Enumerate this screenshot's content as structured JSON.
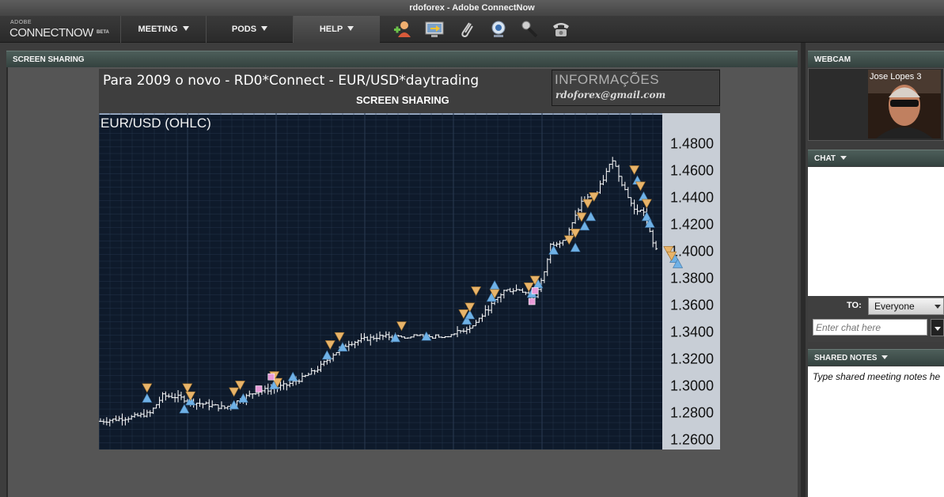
{
  "window": {
    "title": "rdoforex - Adobe ConnectNow"
  },
  "logo": {
    "adobe": "ADOBE",
    "name": "CONNECTNOW",
    "beta": "BETA"
  },
  "menus": {
    "meeting": "MEETING",
    "pods": "PODS",
    "help": "HELP"
  },
  "toolbar_icons": [
    "add-user-icon",
    "share-screen-icon",
    "attachment-icon",
    "webcam-icon",
    "microphone-icon",
    "phone-icon"
  ],
  "screen_sharing": {
    "header": "SCREEN SHARING",
    "banner_title": "Para 2009 o novo  -  RD0*Connect  - EUR/USD*daytrading",
    "banner_sub": "SCREEN SHARING",
    "info_title": "INFORMAÇÕES",
    "info_email": "rdoforex@gmail.com"
  },
  "chart_data": {
    "type": "ohlc",
    "title": "EUR/USD (OHLC)",
    "y_ticks": [
      "1.4800",
      "1.4600",
      "1.4400",
      "1.4200",
      "1.4000",
      "1.3800",
      "1.3600",
      "1.3400",
      "1.3200",
      "1.3000",
      "1.2800",
      "1.2600"
    ],
    "ylim": [
      1.252,
      1.502
    ],
    "grid": true,
    "bar_count": 180,
    "closes": [
      [
        0,
        1.273
      ],
      [
        10,
        1.276
      ],
      [
        16,
        1.279
      ],
      [
        20,
        1.292
      ],
      [
        25,
        1.291
      ],
      [
        30,
        1.287
      ],
      [
        40,
        1.283
      ],
      [
        45,
        1.289
      ],
      [
        50,
        1.295
      ],
      [
        55,
        1.297
      ],
      [
        60,
        1.3
      ],
      [
        65,
        1.305
      ],
      [
        70,
        1.312
      ],
      [
        75,
        1.323
      ],
      [
        80,
        1.331
      ],
      [
        85,
        1.334
      ],
      [
        90,
        1.336
      ],
      [
        96,
        1.336
      ],
      [
        100,
        1.336
      ],
      [
        110,
        1.336
      ],
      [
        115,
        1.339
      ],
      [
        120,
        1.344
      ],
      [
        125,
        1.357
      ],
      [
        130,
        1.37
      ],
      [
        135,
        1.371
      ],
      [
        140,
        1.366
      ],
      [
        143,
        1.383
      ],
      [
        145,
        1.404
      ],
      [
        150,
        1.409
      ],
      [
        155,
        1.436
      ],
      [
        160,
        1.443
      ],
      [
        165,
        1.468
      ],
      [
        168,
        1.45
      ],
      [
        172,
        1.43
      ],
      [
        175,
        1.429
      ],
      [
        178,
        1.405
      ],
      [
        182,
        1.392
      ],
      [
        190,
        1.392
      ]
    ],
    "buy_markers": [
      [
        15,
        1.29
      ],
      [
        27,
        1.282
      ],
      [
        29,
        1.288
      ],
      [
        43,
        1.285
      ],
      [
        46,
        1.29
      ],
      [
        56,
        1.3
      ],
      [
        62,
        1.306
      ],
      [
        73,
        1.322
      ],
      [
        78,
        1.328
      ],
      [
        95,
        1.335
      ],
      [
        105,
        1.336
      ],
      [
        118,
        1.348
      ],
      [
        119,
        1.352
      ],
      [
        126,
        1.365
      ],
      [
        127,
        1.374
      ],
      [
        139,
        1.368
      ],
      [
        141,
        1.375
      ],
      [
        146,
        1.4
      ],
      [
        153,
        1.402
      ],
      [
        156,
        1.418
      ],
      [
        158,
        1.425
      ],
      [
        173,
        1.452
      ],
      [
        175,
        1.44
      ],
      [
        176,
        1.425
      ],
      [
        177,
        1.42
      ],
      [
        185,
        1.394
      ],
      [
        186,
        1.39
      ]
    ],
    "sell_markers": [
      [
        15,
        1.298
      ],
      [
        28,
        1.298
      ],
      [
        29,
        1.292
      ],
      [
        43,
        1.295
      ],
      [
        45,
        1.3
      ],
      [
        56,
        1.307
      ],
      [
        57,
        1.302
      ],
      [
        74,
        1.33
      ],
      [
        77,
        1.336
      ],
      [
        97,
        1.344
      ],
      [
        117,
        1.353
      ],
      [
        119,
        1.358
      ],
      [
        121,
        1.37
      ],
      [
        127,
        1.368
      ],
      [
        138,
        1.373
      ],
      [
        140,
        1.378
      ],
      [
        151,
        1.408
      ],
      [
        153,
        1.413
      ],
      [
        155,
        1.425
      ],
      [
        157,
        1.435
      ],
      [
        159,
        1.44
      ],
      [
        172,
        1.46
      ],
      [
        174,
        1.448
      ],
      [
        176,
        1.435
      ],
      [
        183,
        1.4
      ],
      [
        184,
        1.396
      ]
    ],
    "exit_markers": [
      [
        51,
        1.297
      ],
      [
        55,
        1.306
      ],
      [
        139,
        1.362
      ],
      [
        140,
        1.37
      ]
    ],
    "colors": {
      "background": "#0e1a2b",
      "grid": "#2a3a52",
      "axis_panel": "#c8ced6",
      "bar": "#ffffff",
      "buy": "#6fb1e6",
      "sell": "#e8b46a",
      "exit": "#e89ad8"
    }
  },
  "webcam": {
    "header": "WEBCAM",
    "participant": "Jose Lopes 3"
  },
  "chat": {
    "header": "CHAT",
    "to_label": "TO:",
    "to_value": "Everyone",
    "placeholder": "Enter chat here"
  },
  "shared_notes": {
    "header": "SHARED NOTES",
    "placeholder": "Type shared meeting notes he"
  }
}
